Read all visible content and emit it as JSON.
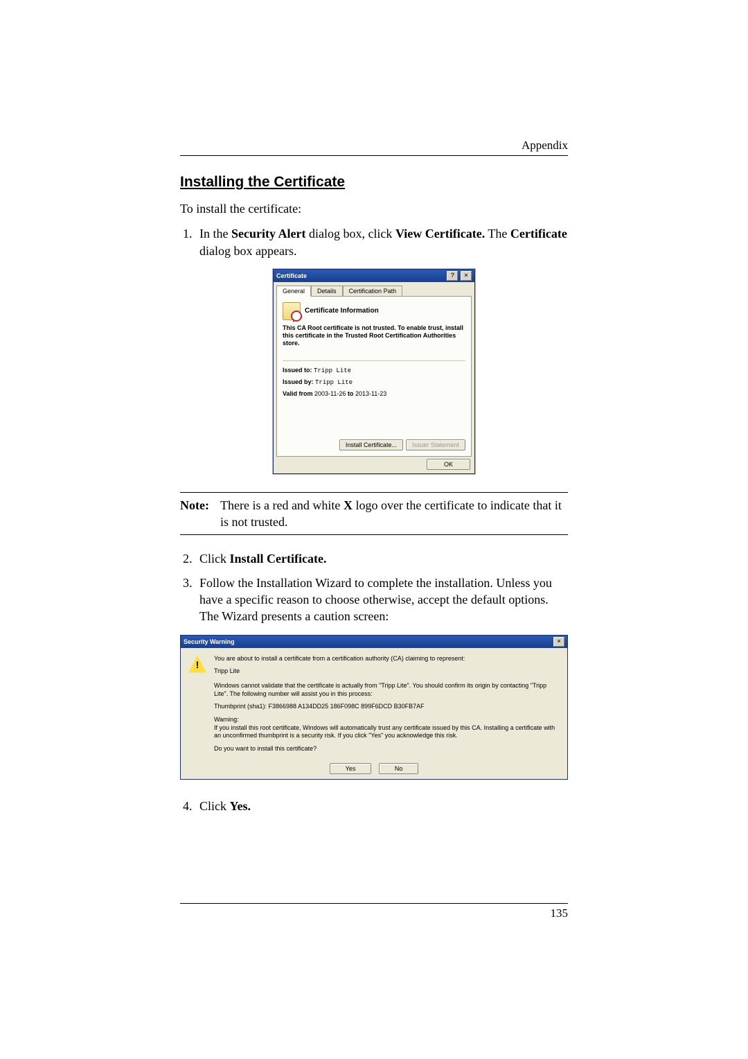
{
  "header": {
    "section": "Appendix"
  },
  "title": "Installing the Certificate",
  "intro": "To install the certificate:",
  "step1": {
    "pre": "In the ",
    "b1": "Security Alert",
    "mid1": " dialog box, click ",
    "b2": "View Certificate.",
    "mid2": " The ",
    "b3": "Certificate",
    "post": " dialog box appears."
  },
  "cert_dialog": {
    "title": "Certificate",
    "help": "?",
    "close": "×",
    "tabs": {
      "general": "General",
      "details": "Details",
      "path": "Certification Path"
    },
    "info_title": "Certificate Information",
    "warning": "This CA Root certificate is not trusted. To enable trust, install this certificate in the Trusted Root Certification Authorities store.",
    "issued_to_label": "Issued to:",
    "issued_to": "Tripp Lite",
    "issued_by_label": "Issued by:",
    "issued_by": "Tripp Lite",
    "valid_label": "Valid from",
    "valid_from": "2003-11-26",
    "valid_to_label": "to",
    "valid_to": "2013-11-23",
    "install_btn": "Install Certificate...",
    "issuer_stmt": "Issuer Statement",
    "ok": "OK"
  },
  "note": {
    "label": "Note:",
    "pre": "There is a red and white ",
    "b": "X",
    "post": " logo over the certificate to indicate that it is not trusted."
  },
  "step2": {
    "pre": "Click ",
    "b": "Install Certificate."
  },
  "step3": "Follow the Installation Wizard to complete the installation. Unless you have a specific reason to choose otherwise, accept the default options. The Wizard presents a caution screen:",
  "sec_dialog": {
    "title": "Security Warning",
    "close": "×",
    "p1": "You are about to install a certificate from a certification authority (CA) claiming to represent:",
    "issuer": "Tripp Lite",
    "p2": "Windows cannot validate that the certificate is actually from \"Tripp Lite\". You should confirm its origin by contacting \"Tripp Lite\". The following number will assist you in this process:",
    "thumb": "Thumbprint (sha1): F3866988 A134DD25 186F098C 899F6DCD B30FB7AF",
    "p3a": "Warning:",
    "p3b": "If you install this root certificate, Windows will automatically trust any certificate issued by this CA. Installing a certificate with an unconfirmed thumbprint is a security risk. If you click \"Yes\" you acknowledge this risk.",
    "p4": "Do you want to install this certificate?",
    "yes": "Yes",
    "no": "No"
  },
  "step4": {
    "pre": "Click ",
    "b": "Yes."
  },
  "page_number": "135"
}
